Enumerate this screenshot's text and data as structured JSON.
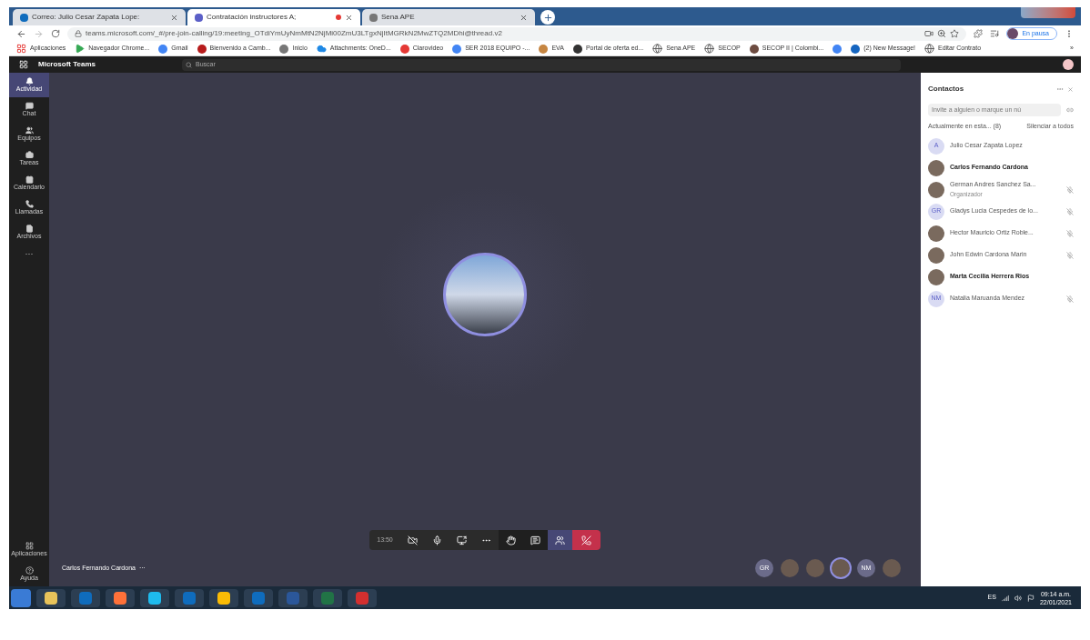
{
  "browser_tabs": [
    {
      "title": "Correo: Julio Cesar Zapata Lope:",
      "kind": "mail",
      "selected": false,
      "recording": false
    },
    {
      "title": "Contratación instructores A;",
      "kind": "teams",
      "selected": true,
      "recording": true
    },
    {
      "title": "Sena APE",
      "kind": "globe",
      "selected": false,
      "recording": false
    }
  ],
  "address": "teams.microsoft.com/_#/pre-join-calling/19:meeting_OTdiYmUyNmMtN2NjMi00ZmU3LTgxNjItMGRkN2MwZTQ2MDhi@thread.v2",
  "profile_status": "En pausa",
  "bookmarks": [
    {
      "label": "Aplicaciones",
      "kind": "apps"
    },
    {
      "label": "Navegador Chrome...",
      "kind": "play"
    },
    {
      "label": "Gmail",
      "kind": "g"
    },
    {
      "label": "Bienvenido a Camb...",
      "kind": "shield"
    },
    {
      "label": "Inicio",
      "kind": "emblem"
    },
    {
      "label": "Attachments: OneD...",
      "kind": "cloud"
    },
    {
      "label": "Clarovideo",
      "kind": "red"
    },
    {
      "label": "SER 2018 EQUIPO -...",
      "kind": "g"
    },
    {
      "label": "EVA",
      "kind": "person"
    },
    {
      "label": "Portal de oferta ed...",
      "kind": "s"
    },
    {
      "label": "Sena APE",
      "kind": "globe"
    },
    {
      "label": "SECOP",
      "kind": "globe"
    },
    {
      "label": "SECOP II | Colombi...",
      "kind": "flag"
    },
    {
      "kind": "g"
    },
    {
      "label": "(2) New Message!",
      "kind": "c"
    },
    {
      "label": "Editar Contrato",
      "kind": "globe"
    }
  ],
  "overflow": "»",
  "app": {
    "title": "Microsoft Teams",
    "search_placeholder": "Buscar"
  },
  "rail": [
    {
      "label": "Actividad",
      "kind": "bell",
      "selected": true
    },
    {
      "label": "Chat",
      "kind": "chat",
      "selected": false
    },
    {
      "label": "Equipos",
      "kind": "teams",
      "selected": false
    },
    {
      "label": "Tareas",
      "kind": "bag",
      "selected": false
    },
    {
      "label": "Calendario",
      "kind": "calendar",
      "selected": false
    },
    {
      "label": "Llamadas",
      "kind": "phone",
      "selected": false
    },
    {
      "label": "Archivos",
      "kind": "file",
      "selected": false
    }
  ],
  "rail_more": "···",
  "rail_bottom": [
    {
      "label": "Aplicaciones",
      "kind": "apps"
    },
    {
      "label": "Ayuda",
      "kind": "help"
    }
  ],
  "speaker": {
    "name": "Carlos Fernando Cardona",
    "more": "···"
  },
  "call_bar": {
    "timer": "13:50",
    "camera_off": true,
    "muted": false
  },
  "bottom_avatars": [
    {
      "initials": "GR",
      "kind": "initials",
      "selected": false
    },
    {
      "kind": "photo",
      "selected": false
    },
    {
      "kind": "photo",
      "selected": false
    },
    {
      "kind": "photo",
      "selected": true
    },
    {
      "initials": "NM",
      "kind": "initials",
      "selected": false
    },
    {
      "kind": "photo",
      "selected": false
    }
  ],
  "contacts": {
    "title": "Contactos",
    "invite_placeholder": "Invite a alguien o marque un nú",
    "section": "Actualmente en esta... (8)",
    "mute_all": "Silenciar a todos",
    "people": [
      {
        "name": "Julio Cesar Zapata Lopez",
        "initials": "A",
        "kind": "initials",
        "active": false,
        "muted": false
      },
      {
        "name": "Carlos Fernando Cardona",
        "kind": "photo",
        "active": true,
        "muted": false
      },
      {
        "name": "German Andres Sanchez Sa...",
        "role": "Organizador",
        "kind": "photo",
        "active": false,
        "muted": true
      },
      {
        "name": "Gladys Lucia Cespedes de lo...",
        "initials": "GR",
        "kind": "initials",
        "active": false,
        "muted": true
      },
      {
        "name": "Hector Mauricio Ortiz Roble...",
        "kind": "photo",
        "active": false,
        "muted": true
      },
      {
        "name": "John Edwin Cardona Marin",
        "kind": "photo",
        "active": false,
        "muted": true
      },
      {
        "name": "Marta Cecilia Herrera Rios",
        "kind": "photo",
        "active": true,
        "muted": false
      },
      {
        "name": "Natalia Maruanda Mendez",
        "initials": "NM",
        "kind": "initials",
        "active": false,
        "muted": true
      }
    ]
  },
  "taskbar": {
    "language": "ES",
    "time": "09:14 a.m.",
    "date": "22/01/2021"
  }
}
